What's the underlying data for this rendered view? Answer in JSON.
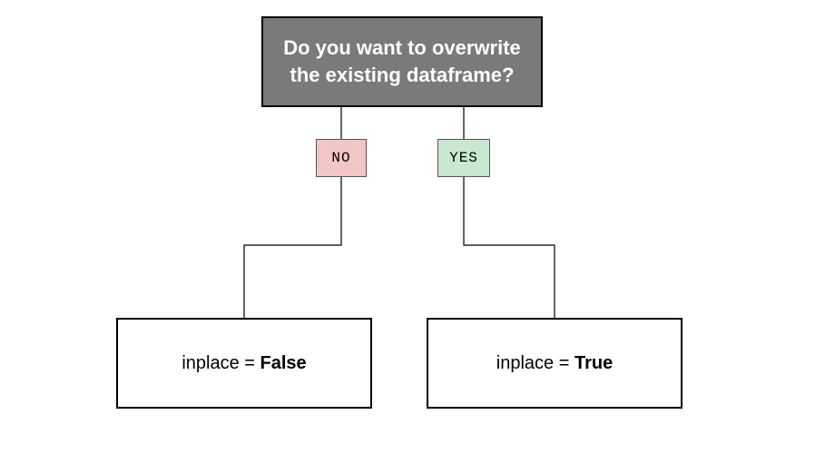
{
  "flow": {
    "question": "Do you want to overwrite the existing dataframe?",
    "choice_no": "NO",
    "choice_yes": "YES",
    "result_left_param": "inplace = ",
    "result_left_value": "False",
    "result_right_param": "inplace = ",
    "result_right_value": "True"
  },
  "chart_data": {
    "type": "flowchart",
    "root": {
      "text": "Do you want to overwrite the existing dataframe?",
      "children": [
        {
          "label": "NO",
          "leaf": "inplace = False"
        },
        {
          "label": "YES",
          "leaf": "inplace = True"
        }
      ]
    }
  }
}
